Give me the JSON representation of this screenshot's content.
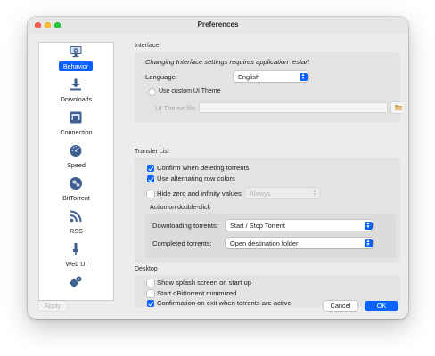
{
  "window": {
    "title": "Preferences"
  },
  "sidebar": {
    "items": [
      {
        "label": "Behavior",
        "icon": "monitor-icon",
        "selected": true
      },
      {
        "label": "Downloads",
        "icon": "download-icon",
        "selected": false
      },
      {
        "label": "Connection",
        "icon": "network-connection-icon",
        "selected": false
      },
      {
        "label": "Speed",
        "icon": "speedometer-icon",
        "selected": false
      },
      {
        "label": "BitTorrent",
        "icon": "bittorrent-icon",
        "selected": false
      },
      {
        "label": "RSS",
        "icon": "rss-icon",
        "selected": false
      },
      {
        "label": "Web UI",
        "icon": "web-ui-icon",
        "selected": false
      },
      {
        "label": "",
        "icon": "gears-icon",
        "selected": false
      }
    ]
  },
  "interface": {
    "title": "Interface",
    "notice": "Changing Interface settings requires application restart",
    "language_label": "Language:",
    "language_value": "English",
    "custom_theme_label": "Use custom UI Theme",
    "custom_theme_checked": false,
    "theme_file_label": "UI Theme file:",
    "theme_file_value": ""
  },
  "transfer_list": {
    "title": "Transfer List",
    "confirm_delete_label": "Confirm when deleting torrents",
    "confirm_delete_checked": true,
    "alternating_rows_label": "Use alternating row colors",
    "alternating_rows_checked": true,
    "hide_zero_label": "Hide zero and infinity values",
    "hide_zero_checked": false,
    "hide_zero_value": "Always",
    "double_click": {
      "title": "Action on double-click",
      "downloading_label": "Downloading torrents:",
      "downloading_value": "Start / Stop Torrent",
      "completed_label": "Completed torrents:",
      "completed_value": "Open destination folder"
    }
  },
  "desktop": {
    "title": "Desktop",
    "splash_label": "Show splash screen on start up",
    "splash_checked": false,
    "minimized_label": "Start qBittorrent minimized",
    "minimized_checked": false,
    "confirm_exit_label": "Confirmation on exit when torrents are active",
    "confirm_exit_checked": true
  },
  "buttons": {
    "apply": "Apply",
    "cancel": "Cancel",
    "ok": "OK"
  },
  "colors": {
    "accent": "#0a63ff",
    "window_bg": "#ececec",
    "group_bg": "#e3e3e3"
  }
}
